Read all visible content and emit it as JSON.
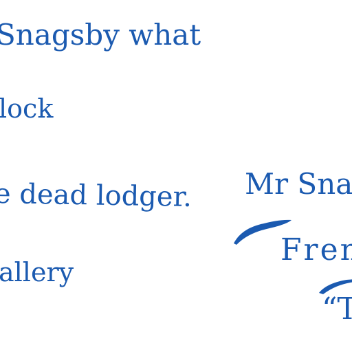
{
  "lines": {
    "snagsby_what": "Snagsby what",
    "clock": "lock",
    "dead_lodger": "e dead lodger.",
    "gallery": "allery",
    "mr_snag": "Mr Snag",
    "fren": "Fren",
    "quote_t": "“T"
  },
  "colors": {
    "ink": "#1b5ab0"
  }
}
